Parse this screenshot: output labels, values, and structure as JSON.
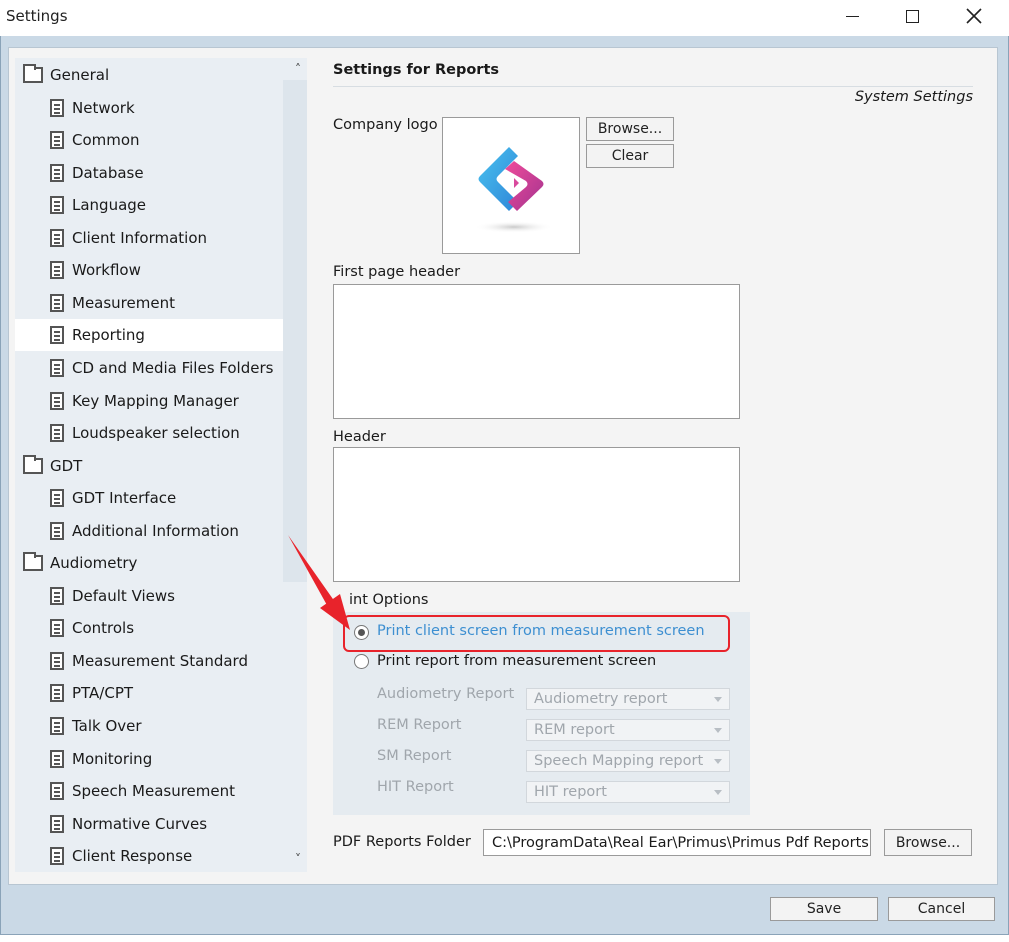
{
  "window": {
    "title": "Settings"
  },
  "nav": {
    "items": [
      {
        "label": "General",
        "type": "folder"
      },
      {
        "label": "Network",
        "type": "doc"
      },
      {
        "label": "Common",
        "type": "doc"
      },
      {
        "label": "Database",
        "type": "doc"
      },
      {
        "label": "Language",
        "type": "doc"
      },
      {
        "label": "Client Information",
        "type": "doc"
      },
      {
        "label": "Workflow",
        "type": "doc"
      },
      {
        "label": "Measurement",
        "type": "doc"
      },
      {
        "label": "Reporting",
        "type": "doc",
        "selected": true
      },
      {
        "label": "CD and Media Files Folders",
        "type": "doc"
      },
      {
        "label": "Key Mapping Manager",
        "type": "doc"
      },
      {
        "label": "Loudspeaker selection",
        "type": "doc"
      },
      {
        "label": "GDT",
        "type": "folder"
      },
      {
        "label": "GDT Interface",
        "type": "doc"
      },
      {
        "label": "Additional Information",
        "type": "doc"
      },
      {
        "label": "Audiometry",
        "type": "folder"
      },
      {
        "label": "Default Views",
        "type": "doc"
      },
      {
        "label": "Controls",
        "type": "doc"
      },
      {
        "label": "Measurement Standard",
        "type": "doc"
      },
      {
        "label": "PTA/CPT",
        "type": "doc"
      },
      {
        "label": "Talk Over",
        "type": "doc"
      },
      {
        "label": "Monitoring",
        "type": "doc"
      },
      {
        "label": "Speech Measurement",
        "type": "doc"
      },
      {
        "label": "Normative Curves",
        "type": "doc"
      },
      {
        "label": "Client Response",
        "type": "doc"
      }
    ]
  },
  "content": {
    "heading": "Settings for Reports",
    "scope": "System Settings",
    "logo": {
      "label": "Company logo",
      "browse": "Browse...",
      "clear": "Clear"
    },
    "first_page_header": {
      "label": "First page header",
      "value": ""
    },
    "header": {
      "label": "Header",
      "value": ""
    },
    "print_options": {
      "label": "int Options",
      "option_client": "Print client screen from measurement screen",
      "option_report": "Print report from measurement screen",
      "audiometry_label": "Audiometry Report",
      "audiometry_value": "Audiometry report",
      "rem_label": "REM Report",
      "rem_value": "REM report",
      "sm_label": "SM Report",
      "sm_value": "Speech Mapping report",
      "hit_label": "HIT Report",
      "hit_value": "HIT report"
    },
    "pdf": {
      "label": "PDF Reports Folder",
      "value": "C:\\ProgramData\\Real Ear\\Primus\\Primus Pdf Reports",
      "browse": "Browse..."
    }
  },
  "footer": {
    "save": "Save",
    "cancel": "Cancel"
  },
  "colors": {
    "accent_red": "#e8232b",
    "link_blue": "#3d8fd1",
    "selected_bg": "#ffffff"
  }
}
